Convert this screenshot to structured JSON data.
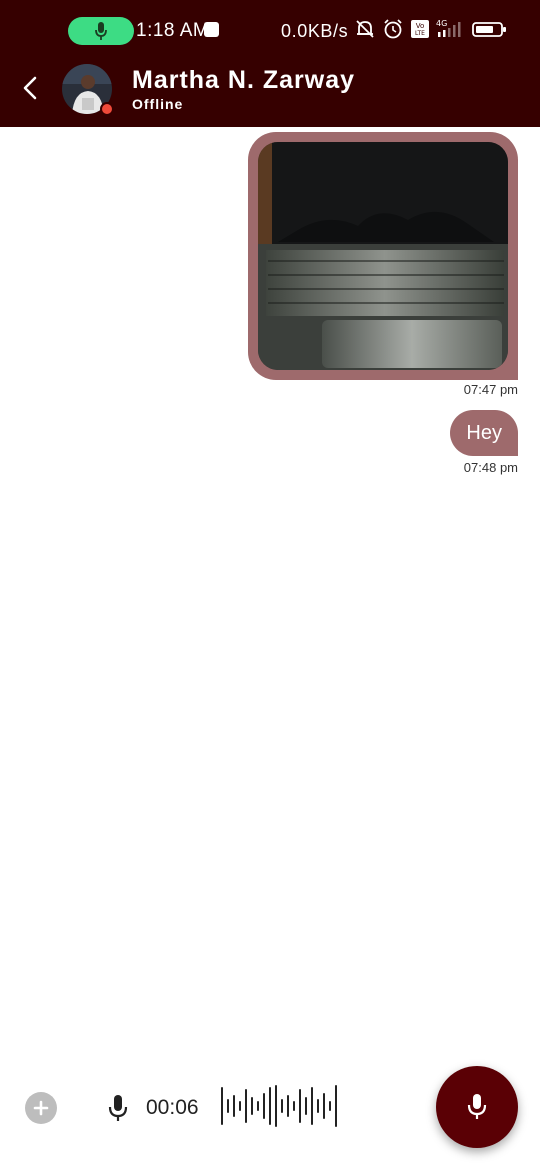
{
  "status_bar": {
    "time": "1:18 AM",
    "network_speed": "0.0KB/s",
    "network_type": "4G",
    "volte": "Vo LTE"
  },
  "header": {
    "contact_name": "Martha N. Zarway",
    "contact_status": "Offline"
  },
  "messages": [
    {
      "type": "image",
      "content": "laptop keyboard photo",
      "time": "07:47 pm"
    },
    {
      "type": "text",
      "text": "Hey",
      "time": "07:48 pm"
    }
  ],
  "recorder": {
    "timer": "00:06"
  },
  "colors": {
    "header_bg": "#360000",
    "bubble_bg": "#9e6a6c",
    "record_button": "#5a0005",
    "mic_pill": "#3ddc84",
    "presence_offline": "#f04a3a"
  },
  "icons": {
    "back": "chevron-left-icon",
    "attach": "plus-icon",
    "mic": "microphone-icon",
    "send_mic": "microphone-icon"
  }
}
